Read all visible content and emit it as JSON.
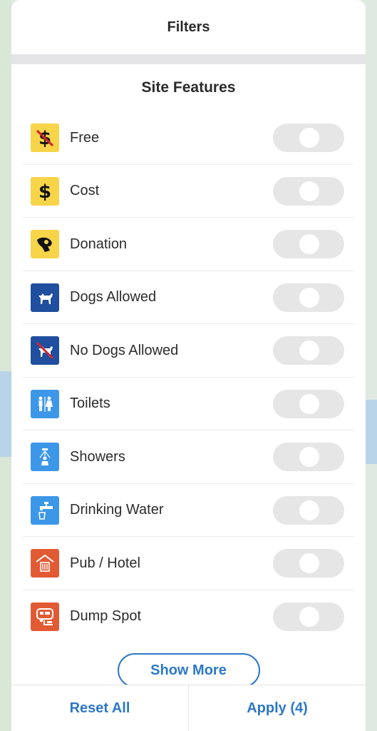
{
  "header": {
    "title": "Filters"
  },
  "section": {
    "title": "Site Features"
  },
  "features": [
    {
      "label": "Free",
      "icon": "free-icon",
      "enabled": false,
      "color": "#f7d448"
    },
    {
      "label": "Cost",
      "icon": "cost-icon",
      "enabled": false,
      "color": "#f7d448"
    },
    {
      "label": "Donation",
      "icon": "donation-icon",
      "enabled": false,
      "color": "#f7d448"
    },
    {
      "label": "Dogs Allowed",
      "icon": "dog-icon",
      "enabled": false,
      "color": "#1f4f9e"
    },
    {
      "label": "No Dogs Allowed",
      "icon": "no-dog-icon",
      "enabled": false,
      "color": "#1f4f9e"
    },
    {
      "label": "Toilets",
      "icon": "toilet-icon",
      "enabled": false,
      "color": "#3d97e8"
    },
    {
      "label": "Showers",
      "icon": "shower-icon",
      "enabled": false,
      "color": "#3d97e8"
    },
    {
      "label": "Drinking Water",
      "icon": "tap-icon",
      "enabled": false,
      "color": "#3d97e8"
    },
    {
      "label": "Pub / Hotel",
      "icon": "pub-icon",
      "enabled": false,
      "color": "#e25a34"
    },
    {
      "label": "Dump Spot",
      "icon": "dump-icon",
      "enabled": false,
      "color": "#e25a34"
    }
  ],
  "show_more_label": "Show More",
  "footer": {
    "reset_label": "Reset All",
    "apply_label": "Apply (4)"
  },
  "colors": {
    "accent": "#2d78c6",
    "toggle_off": "#e6e6e6"
  }
}
